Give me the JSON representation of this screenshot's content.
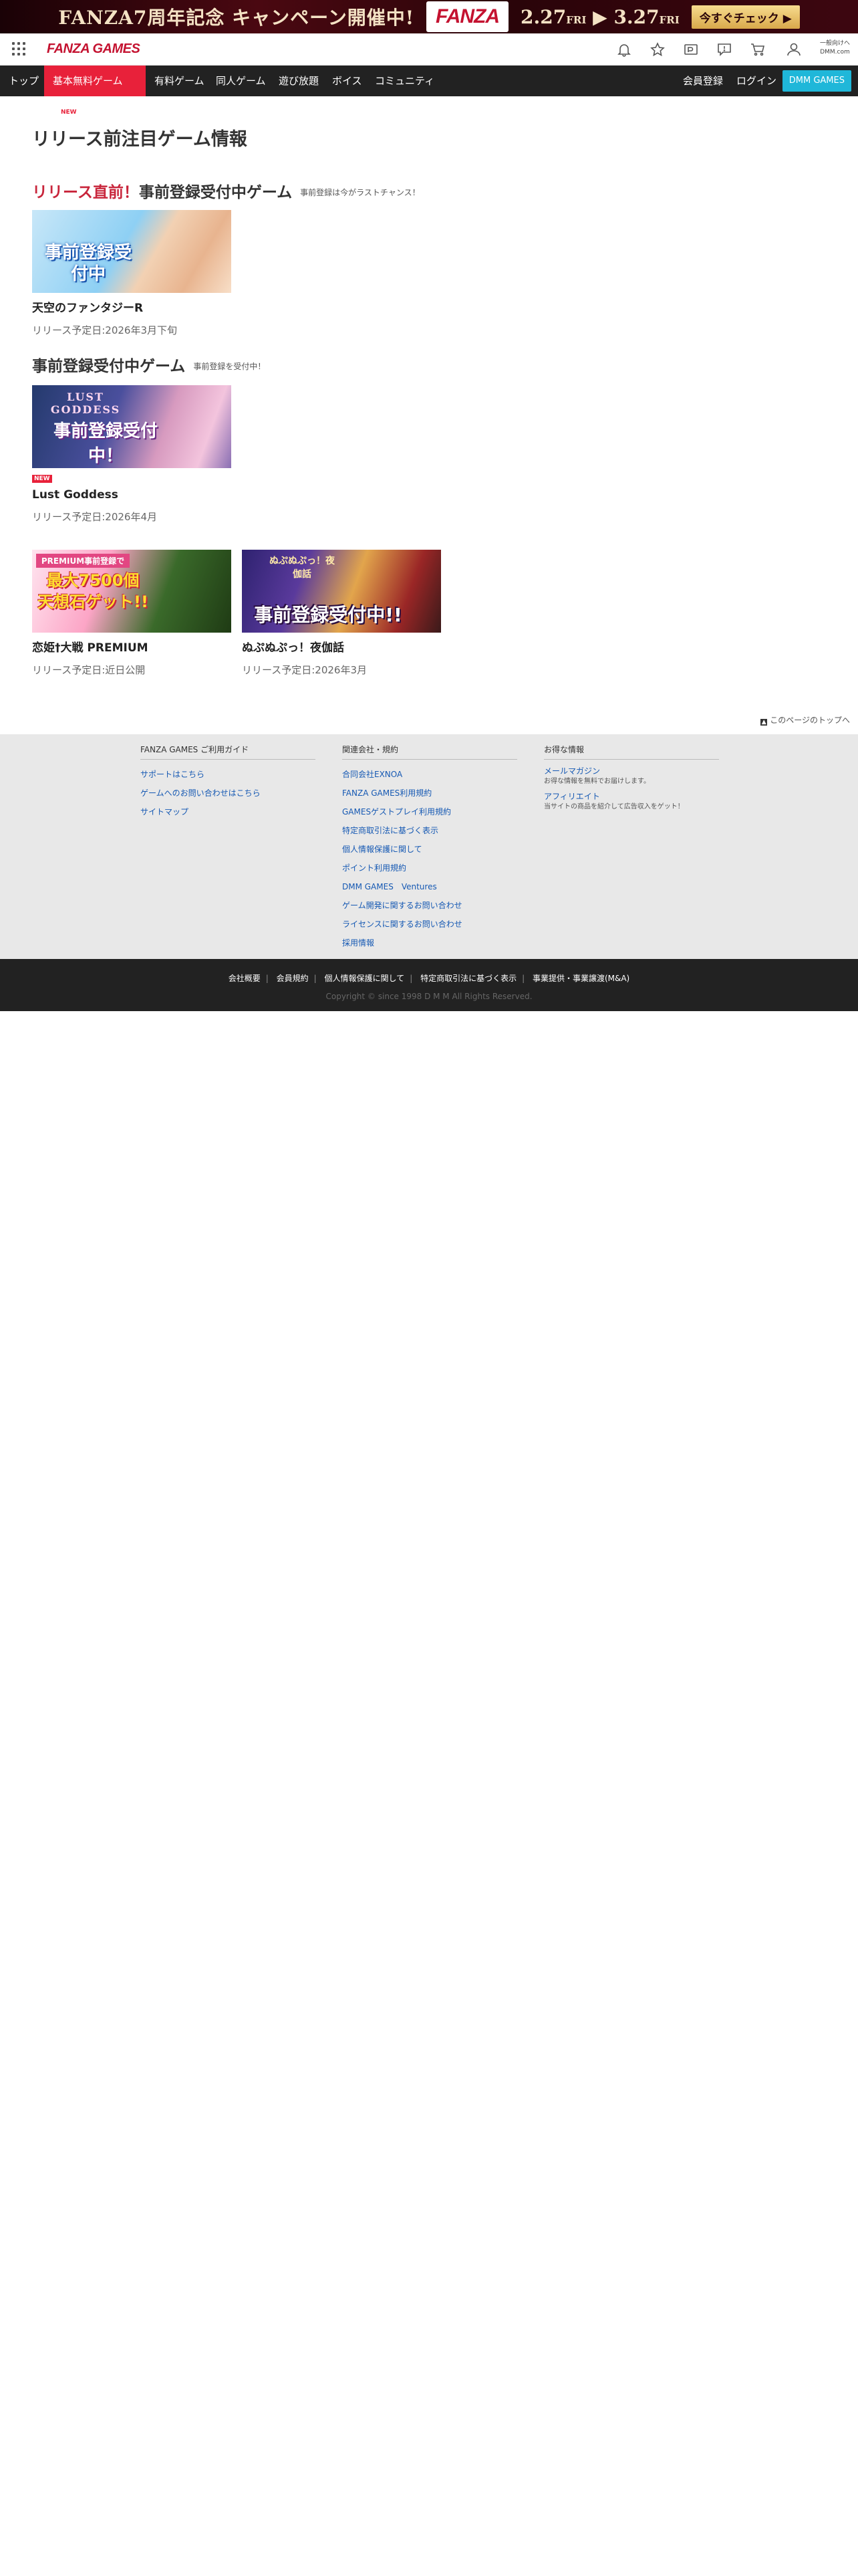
{
  "banner": {
    "headline": "FANZA7周年記念 キャンペーン開催中!",
    "logo": "FANZA",
    "start_date": "2.27",
    "start_day": "FRI",
    "arrow": "▶",
    "end_date": "3.27",
    "end_day": "FRI",
    "cta": "今すぐチェック ▶"
  },
  "header": {
    "logo": "FANZA GAMES",
    "dmm_link_line1": "一般向けへ",
    "dmm_link_line2": "DMM.com",
    "icons": [
      "bell-icon",
      "star-icon",
      "point-icon",
      "chat-icon",
      "cart-icon",
      "user-icon"
    ]
  },
  "nav": {
    "items": [
      {
        "label": "トップ"
      },
      {
        "label": "基本無料ゲーム",
        "badge": "NEW",
        "active": true
      },
      {
        "label": "有料ゲーム"
      },
      {
        "label": "同人ゲーム"
      },
      {
        "label": "遊び放題"
      },
      {
        "label": "ボイス"
      },
      {
        "label": "コミュニティ"
      }
    ],
    "register": "会員登録",
    "login": "ログイン",
    "dmm_games": "DMM GAMES"
  },
  "main": {
    "title": "リリース前注目ゲーム情報",
    "section1": {
      "accent": "リリース直前！",
      "heading": "事前登録受付中ゲーム",
      "sub": "事前登録は今がラストチャンス！",
      "games": [
        {
          "name": "天空のファンタジーR",
          "date": "リリース予定日:2026年3月下旬",
          "thumb_text": "事前登録受付中"
        }
      ]
    },
    "section2": {
      "heading": "事前登録受付中ゲーム",
      "sub": "事前登録を受付中！",
      "games": [
        {
          "name": "Lust Goddess",
          "date": "リリース予定日:2026年4月",
          "badge": "NEW",
          "thumb_text": "事前登録受付中！",
          "thumb_logo": "LUST GODDESS"
        },
        {
          "name": "恋姫†大戦 PREMIUM",
          "date": "リリース予定日:近日公開",
          "thumb_text": "最大7500個 天想石ゲット!!",
          "thumb_top": "PREMIUM事前登録で"
        },
        {
          "name": "ぬぷぬぷっ！夜伽話",
          "date": "リリース予定日:2026年3月",
          "thumb_text": "事前登録受付中!!",
          "thumb_logo": "ぬぷぬぷっ！夜伽話"
        }
      ]
    }
  },
  "pagetop": "このページのトップへ",
  "footer": {
    "col1": {
      "title": "FANZA GAMES ご利用ガイド",
      "links": [
        "サポートはこちら",
        "ゲームへのお問い合わせはこちら",
        "サイトマップ"
      ]
    },
    "col2": {
      "title": "関連会社・規約",
      "links": [
        "合同会社EXNOA",
        "FANZA GAMES利用規約",
        "GAMESゲストプレイ利用規約",
        "特定商取引法に基づく表示",
        "個人情報保護に関して",
        "ポイント利用規約",
        "DMM GAMES　Ventures",
        "ゲーム開発に関するお問い合わせ",
        "ライセンスに関するお問い合わせ",
        "採用情報"
      ]
    },
    "col3": {
      "title": "お得な情報",
      "items": [
        {
          "link": "メールマガジン",
          "desc": "お得な情報を無料でお届けします。"
        },
        {
          "link": "アフィリエイト",
          "desc": "当サイトの商品を紹介して広告収入をゲット！"
        }
      ]
    }
  },
  "bottom": {
    "links": [
      "会社概要",
      "会員規約",
      "個人情報保護に関して",
      "特定商取引法に基づく表示",
      "事業提供・事業譲渡(M&A)"
    ],
    "copyright": "Copyright © since 1998 D M M All Rights Reserved."
  }
}
